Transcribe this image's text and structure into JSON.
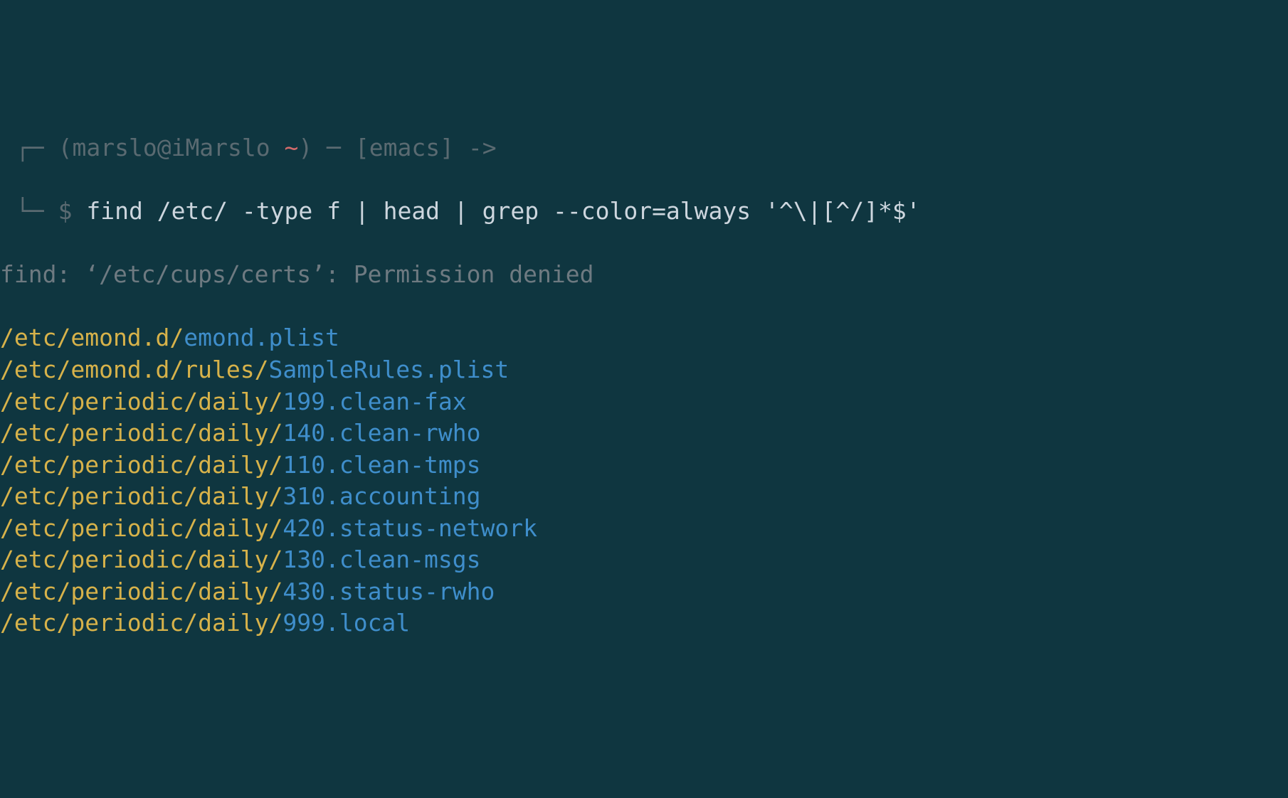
{
  "prompt": {
    "corner_top": "┌",
    "dash": "─",
    "lp": "(",
    "user_host": "marslo@iMarslo ",
    "tilde": "~",
    "rp": ")",
    "lb": "[",
    "mode": "emacs",
    "rb": "]",
    "arrow": "->",
    "corner_bot": "└",
    "dollar": " $ ",
    "cmd": "find /etc/ -type f | head | grep --color=always '^\\|[^/]*$'"
  },
  "error": "find: ‘/etc/cups/certs’: Permission denied",
  "lines": [
    {
      "dir": "/etc/emond.d/",
      "base": "emond.plist"
    },
    {
      "dir": "/etc/emond.d/rules/",
      "base": "SampleRules.plist"
    },
    {
      "dir": "/etc/periodic/daily/",
      "base": "199.clean-fax"
    },
    {
      "dir": "/etc/periodic/daily/",
      "base": "140.clean-rwho"
    },
    {
      "dir": "/etc/periodic/daily/",
      "base": "110.clean-tmps"
    },
    {
      "dir": "/etc/periodic/daily/",
      "base": "310.accounting"
    },
    {
      "dir": "/etc/periodic/daily/",
      "base": "420.status-network"
    },
    {
      "dir": "/etc/periodic/daily/",
      "base": "130.clean-msgs"
    },
    {
      "dir": "/etc/periodic/daily/",
      "base": "430.status-rwho"
    },
    {
      "dir": "/etc/periodic/daily/",
      "base": "999.local"
    }
  ]
}
